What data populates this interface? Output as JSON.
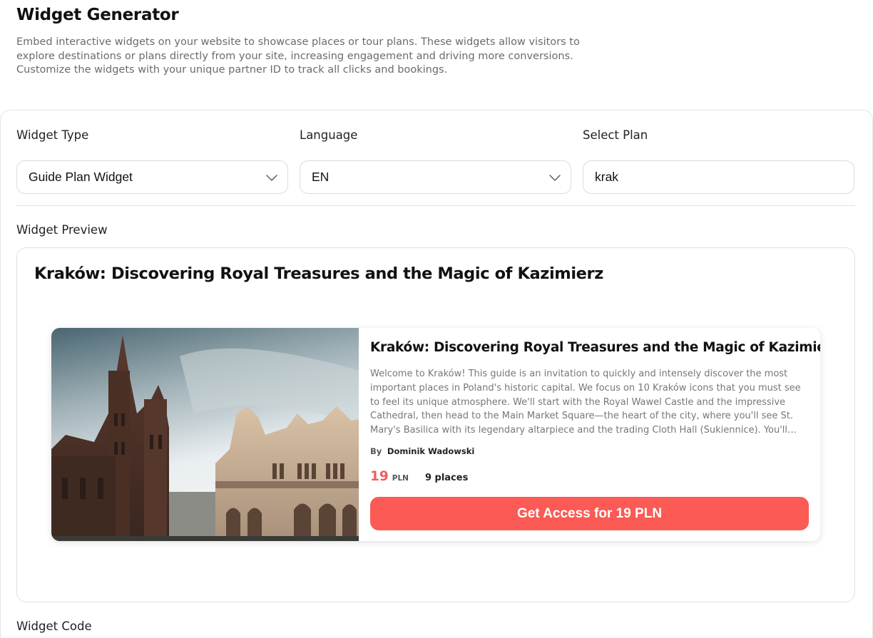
{
  "header": {
    "title": "Widget Generator",
    "description": "Embed interactive widgets on your website to showcase places or tour plans. These widgets allow visitors to explore destinations or plans directly from your site, increasing engagement and driving more conversions. Customize the widgets with your unique partner ID to track all clicks and bookings."
  },
  "form": {
    "widget_type_label": "Widget Type",
    "widget_type_value": "Guide Plan Widget",
    "language_label": "Language",
    "language_value": "EN",
    "select_plan_label": "Select Plan",
    "select_plan_value": "krak"
  },
  "preview": {
    "label": "Widget Preview",
    "heading": "Kraków: Discovering Royal Treasures and the Magic of Kazimierz",
    "card": {
      "title": "Kraków: Discovering Royal Treasures and the Magic of Kazimierz",
      "description": "Welcome to Kraków! This guide is an invitation to quickly and intensely discover the most important places in Poland's historic capital. We focus on 10 Kraków icons that you must see to feel its unique atmosphere. We'll start with the Royal Wawel Castle and the impressive Cathedral, then head to the Main Market Square—the heart of the city, where you'll see St. Mary's Basilica with its legendary altarpiece and the trading Cloth Hall (Sukiennice). You'll also discover dark...",
      "by_label": "By",
      "author": "Dominik Wadowski",
      "price": "19",
      "currency": "PLN",
      "places": "9 places",
      "cta_label": "Get Access for 19 PLN",
      "image": "krakow-main-square-photo"
    }
  },
  "code": {
    "label": "Widget Code"
  },
  "colors": {
    "accent": "#fb5a55",
    "price": "#f25c5c",
    "border": "#e0e0e0"
  },
  "icons": {
    "dropdown": "chevron-down-icon"
  }
}
